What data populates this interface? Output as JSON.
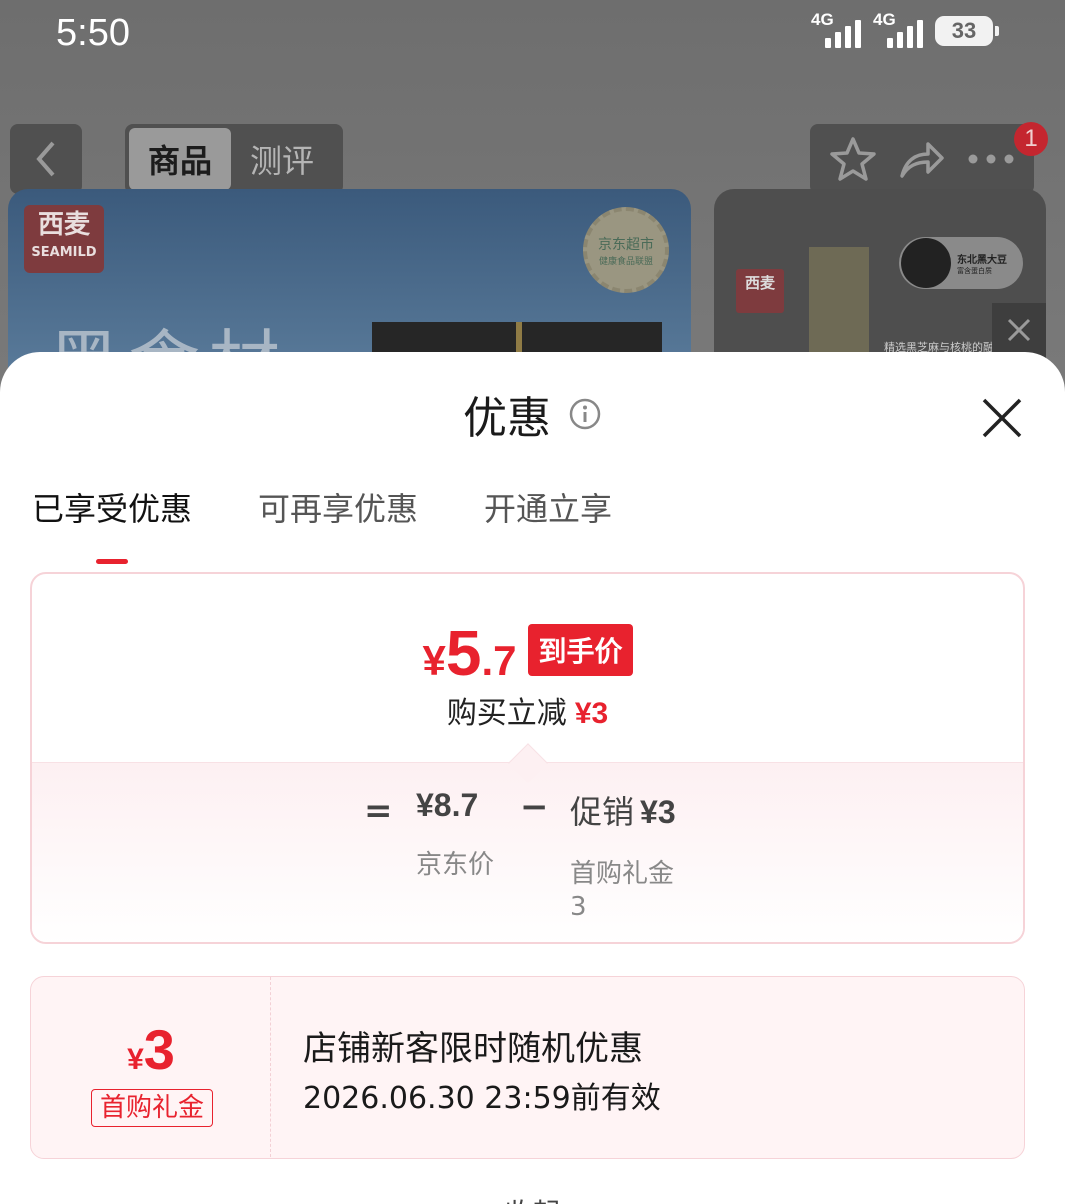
{
  "status_bar": {
    "time": "5:50",
    "signal1": "4G",
    "signal2": "4G",
    "battery": "33"
  },
  "nav": {
    "tabs": [
      {
        "label": "商品"
      },
      {
        "label": "测评"
      }
    ],
    "badge_count": "1"
  },
  "background": {
    "brand_cn": "西麦",
    "brand_en": "SEAMILD",
    "seal_text": "京东超市",
    "seal_sub": "健康食品联盟",
    "headline": "黑食材",
    "side_brand": "西麦",
    "bean_label": "东北黑大豆",
    "bean_sub": "富含蛋白质",
    "side_caption": "精选黑芝麻与核桃的融合"
  },
  "sheet": {
    "title": "优惠",
    "tabs": [
      {
        "label": "已享受优惠"
      },
      {
        "label": "可再享优惠"
      },
      {
        "label": "开通立享"
      }
    ],
    "final_price": {
      "currency": "¥",
      "integer": "5",
      "decimal": ".7",
      "tag": "到手价",
      "reduce_label": "购买立减",
      "reduce_amount": "¥3"
    },
    "breakdown": {
      "equals": "=",
      "jd_price": "¥8.7",
      "jd_price_label": "京东价",
      "minus": "−",
      "promo_label": "促销",
      "promo_amount": "¥3",
      "promo_detail": "首购礼金",
      "promo_detail_value": "3"
    },
    "coupon": {
      "currency": "¥",
      "amount": "3",
      "type": "首购礼金",
      "title": "店铺新客限时随机优惠",
      "validity": "2026.06.30 23:59前有效"
    },
    "collapse_label": "收起"
  },
  "colors": {
    "accent": "#e8222e",
    "card_border": "#f6d3d8",
    "coupon_bg": "#fff4f5"
  }
}
